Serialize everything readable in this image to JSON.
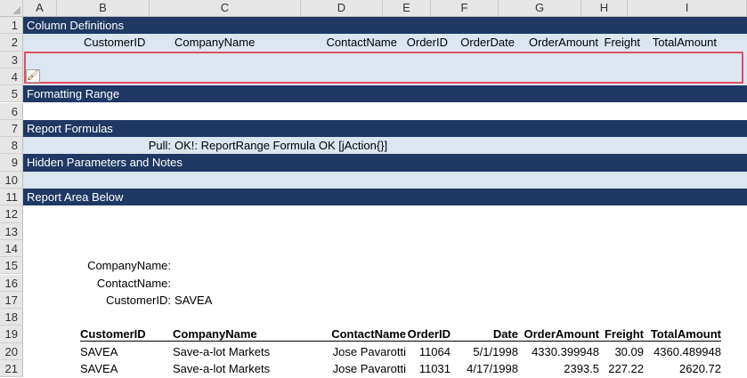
{
  "columns": [
    "A",
    "B",
    "C",
    "D",
    "E",
    "F",
    "G",
    "H",
    "I"
  ],
  "rows": [
    "1",
    "2",
    "3",
    "4",
    "5",
    "6",
    "7",
    "8",
    "9",
    "10",
    "11",
    "12",
    "13",
    "14",
    "15",
    "16",
    "17",
    "18",
    "19",
    "20",
    "21"
  ],
  "sections": {
    "column_definitions": "Column Definitions",
    "formatting_range": "Formatting Range",
    "report_formulas": "Report Formulas",
    "hidden_parameters": "Hidden Parameters and Notes",
    "report_area": "Report Area Below"
  },
  "column_defs": [
    "CustomerID",
    "CompanyName",
    "ContactName",
    "OrderID",
    "OrderDate",
    "OrderAmount",
    "Freight",
    "TotalAmount"
  ],
  "pull": {
    "label": "Pull:",
    "value": "OK!: ReportRange Formula OK [jAction{}]"
  },
  "params": [
    {
      "label": "CompanyName:",
      "value": ""
    },
    {
      "label": "ContactName:",
      "value": ""
    },
    {
      "label": "CustomerID:",
      "value": "SAVEA"
    }
  ],
  "table": {
    "headers": [
      "CustomerID",
      "CompanyName",
      "ContactName",
      "OrderID",
      "Date",
      "OrderAmount",
      "Freight",
      "TotalAmount"
    ],
    "rows": [
      [
        "SAVEA",
        "Save-a-lot Markets",
        "Jose Pavarotti",
        "11064",
        "5/1/1998",
        "4330.399948",
        "30.09",
        "4360.489948"
      ],
      [
        "SAVEA",
        "Save-a-lot Markets",
        "Jose Pavarotti",
        "11031",
        "4/17/1998",
        "2393.5",
        "227.22",
        "2620.72"
      ]
    ]
  },
  "icons": {
    "format_painter": "paintbrush-icon"
  }
}
